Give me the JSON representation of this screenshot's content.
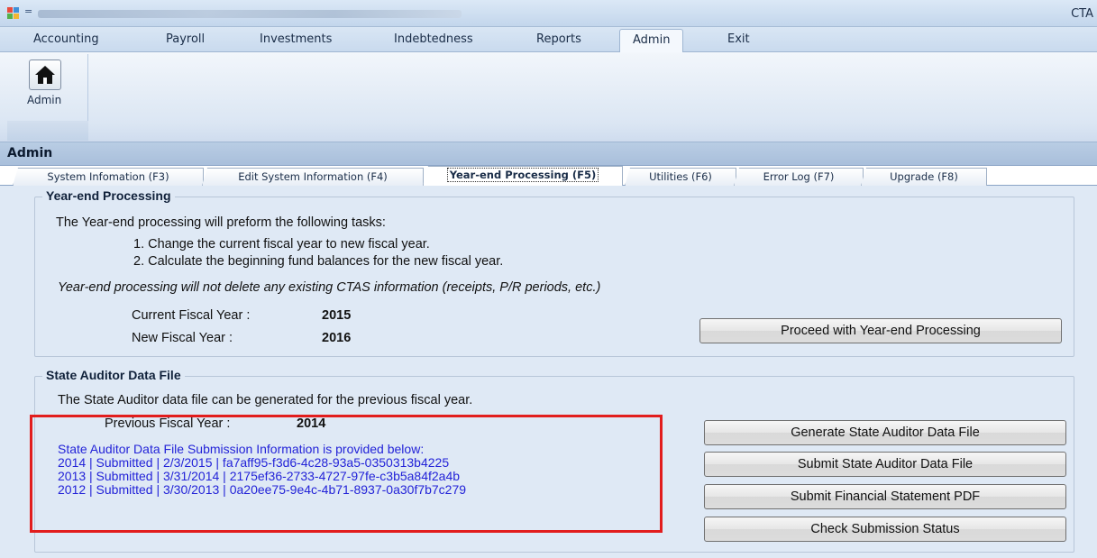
{
  "window": {
    "title_right": "CTA",
    "qat_symbol": "="
  },
  "menu": {
    "items": [
      {
        "label": "Accounting"
      },
      {
        "label": "Payroll"
      },
      {
        "label": "Investments"
      },
      {
        "label": "Indebtedness"
      },
      {
        "label": "Reports"
      },
      {
        "label": "Admin"
      },
      {
        "label": "Exit"
      }
    ]
  },
  "ribbon": {
    "admin_label": "Admin"
  },
  "section": {
    "title": "Admin"
  },
  "tabs": [
    {
      "label": "System Infomation (F3)"
    },
    {
      "label": "Edit System Information (F4)"
    },
    {
      "label": "Year-end Processing (F5)"
    },
    {
      "label": "Utilities (F6)"
    },
    {
      "label": "Error Log (F7)"
    },
    {
      "label": "Upgrade (F8)"
    }
  ],
  "year_end": {
    "legend": "Year-end Processing",
    "intro": "The Year-end processing will preform the following tasks:",
    "task1": "1. Change the current fiscal year to new fiscal year.",
    "task2": "2. Calculate the beginning fund balances for the new fiscal year.",
    "note": "Year-end processing will not delete any existing CTAS information (receipts, P/R periods, etc.)",
    "current_label": "Current Fiscal Year :",
    "current_value": "2015",
    "new_label": "New Fiscal Year :",
    "new_value": "2016",
    "proceed_button": "Proceed with Year-end Processing"
  },
  "auditor": {
    "legend": "State Auditor Data File",
    "intro": "The State Auditor data file can be generated for the previous fiscal year.",
    "previous_label": "Previous Fiscal Year :",
    "previous_value": "2014",
    "info_header": "State Auditor Data File Submission Information is provided below:",
    "submissions": [
      "2014 | Submitted | 2/3/2015 | fa7aff95-f3d6-4c28-93a5-0350313b4225",
      "2013 | Submitted | 3/31/2014 | 2175ef36-2733-4727-97fe-c3b5a84f2a4b",
      "2012 | Submitted | 3/30/2013 | 0a20ee75-9e4c-4b71-8937-0a30f7b7c279"
    ],
    "buttons": {
      "generate": "Generate State Auditor Data File",
      "submit": "Submit State Auditor Data File",
      "submit_pdf": "Submit Financial Statement PDF",
      "check": "Check Submission Status"
    }
  },
  "colors": {
    "highlight": "#e21d1d",
    "submission_text": "#2323d8",
    "content_bg": "#dfe9f5"
  }
}
